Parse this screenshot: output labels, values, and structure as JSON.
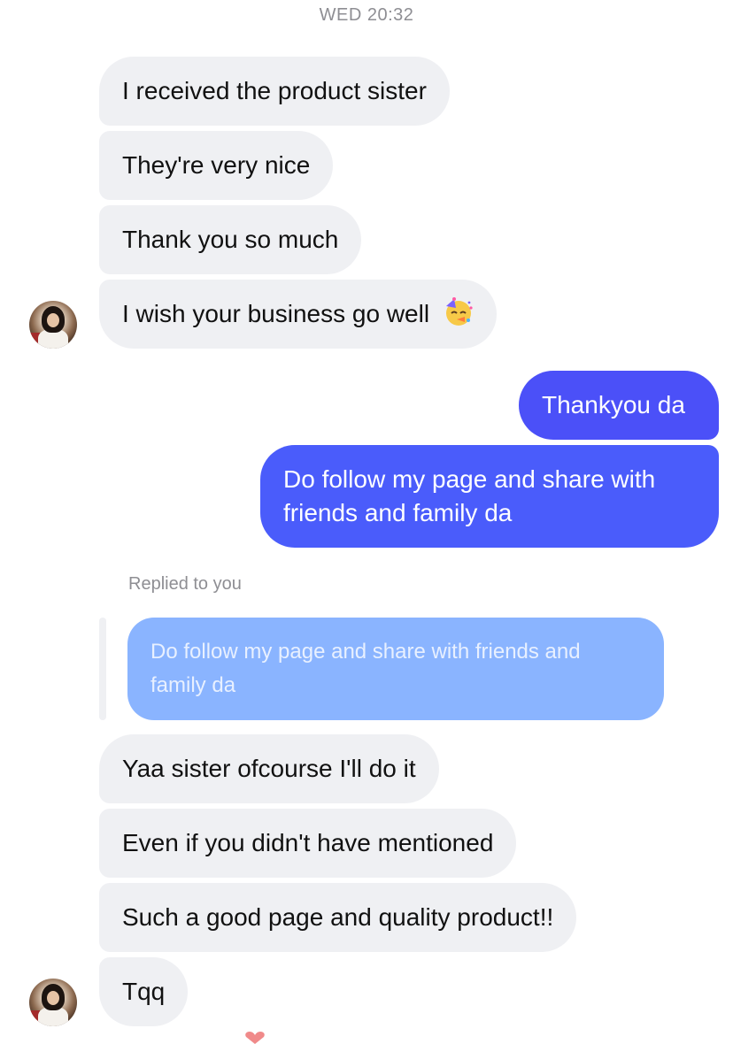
{
  "header": {
    "timestamp": "WED 20:32"
  },
  "messages": [
    {
      "from": "them",
      "text": "I received the product sister"
    },
    {
      "from": "them",
      "text": "They're very nice"
    },
    {
      "from": "them",
      "text": "Thank you so much"
    },
    {
      "from": "them",
      "text": "I wish your business go well",
      "emoji": "partying-face-emoji"
    },
    {
      "from": "me",
      "text": "Thankyou da"
    },
    {
      "from": "me",
      "text_lines": [
        "Do follow my page and share with",
        "friends and family da"
      ]
    },
    {
      "from": "them",
      "text": "Yaa sister ofcourse I'll do it"
    },
    {
      "from": "them",
      "text": "Even if you didn't have mentioned"
    },
    {
      "from": "them",
      "text": "Such a good page and quality product!!"
    },
    {
      "from": "them",
      "text": "Tqq"
    }
  ],
  "reply": {
    "label": "Replied to you",
    "quoted_lines": [
      "Do follow my page and share with friends and",
      "family da"
    ]
  },
  "colors": {
    "incoming_bubble": "#eff0f3",
    "outgoing_bubble": "#4d54f8",
    "quoted_bubble": "#8ab4ff",
    "meta_text": "#8e8e93"
  }
}
